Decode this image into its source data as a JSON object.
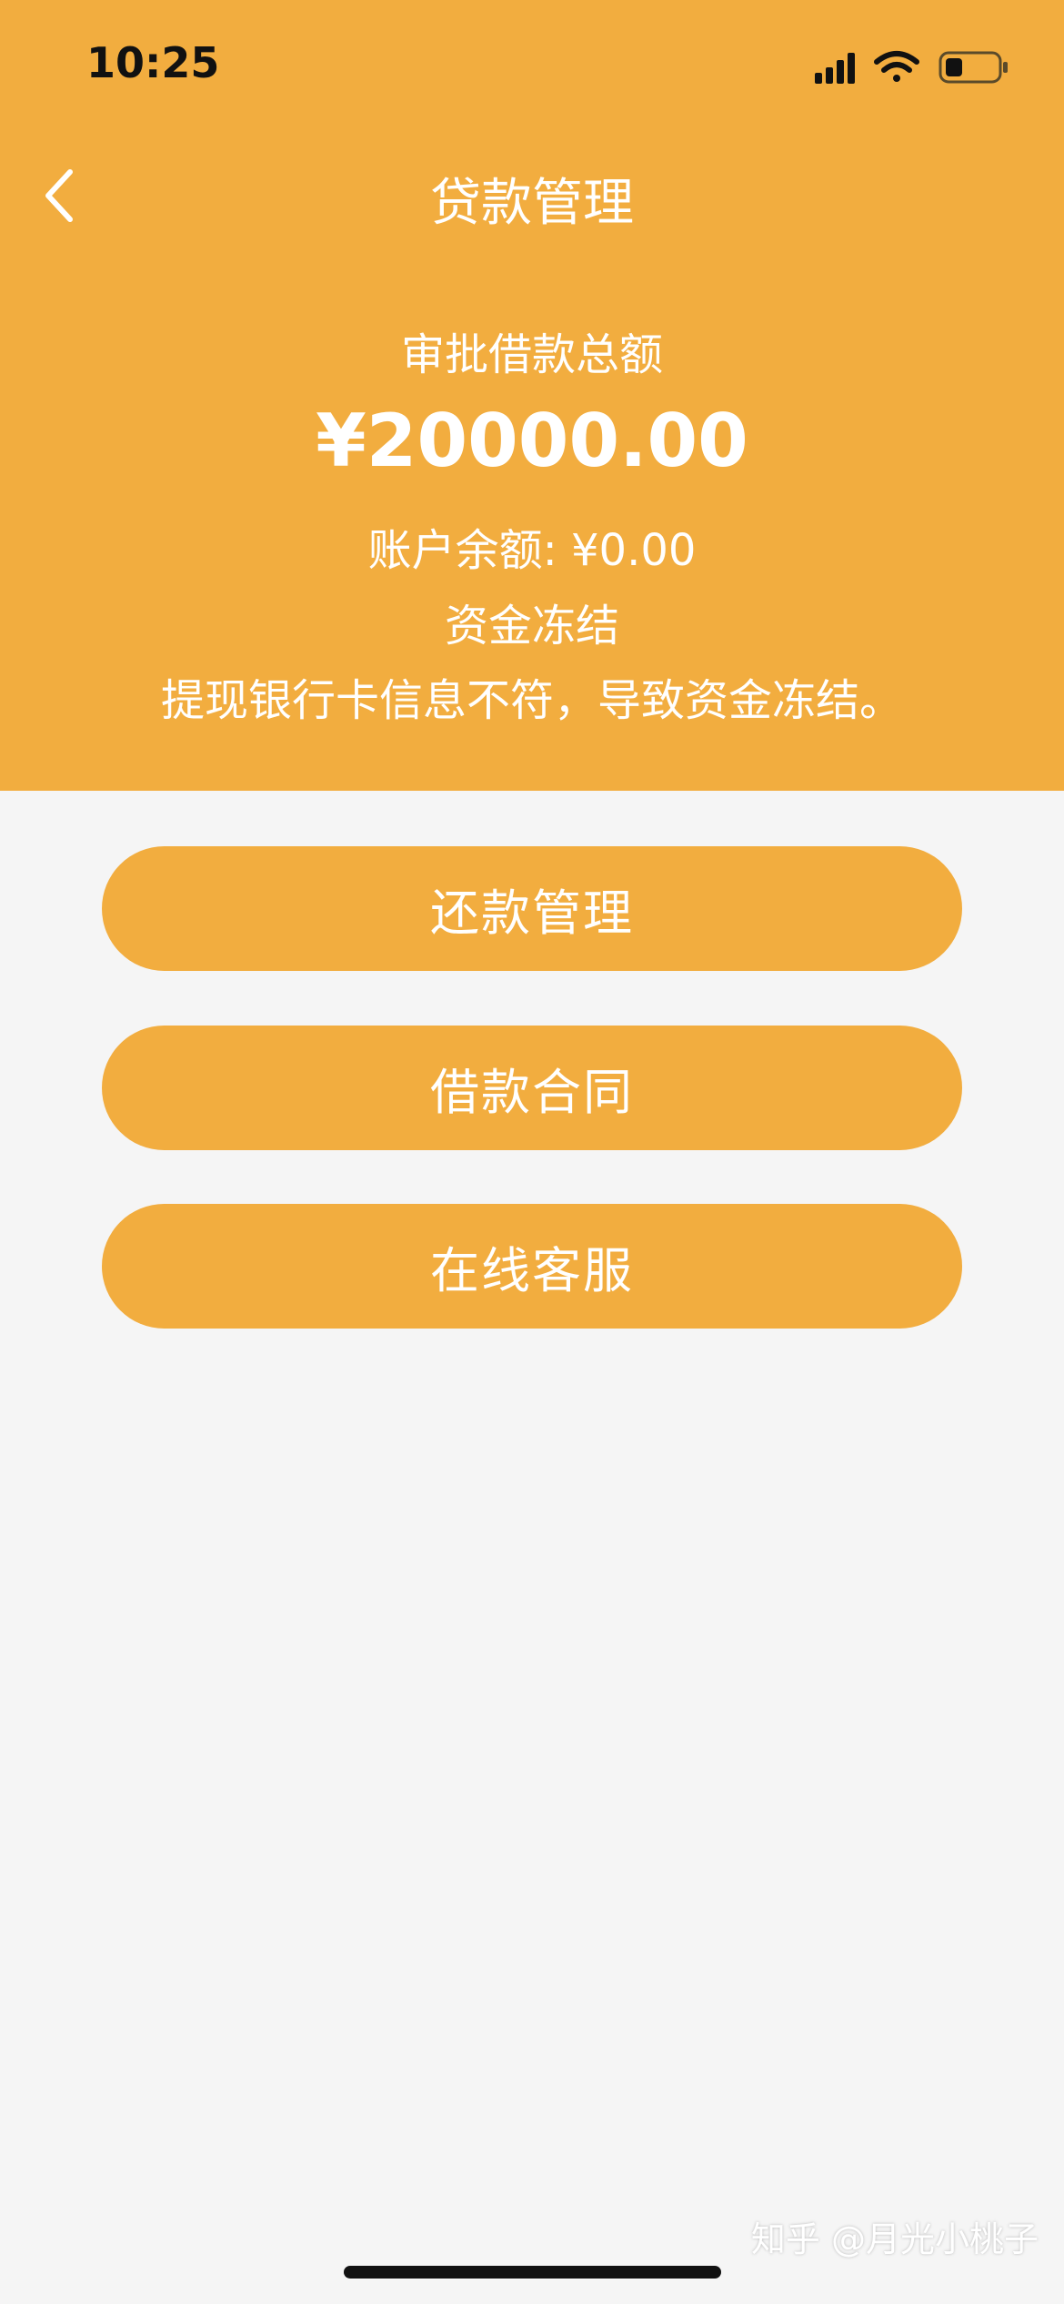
{
  "status_bar": {
    "time": "10:25",
    "icons": [
      "signal-icon",
      "wifi-icon",
      "battery-icon"
    ]
  },
  "nav": {
    "back_icon": "chevron-left-icon",
    "title": "贷款管理"
  },
  "summary": {
    "approved_label": "审批借款总额",
    "approved_amount": "¥20000.00",
    "balance": "账户余额: ¥0.00",
    "status": "资金冻结",
    "reason": "提现银行卡信息不符，导致资金冻结。"
  },
  "actions": [
    {
      "label": "还款管理"
    },
    {
      "label": "借款合同"
    },
    {
      "label": "在线客服"
    }
  ],
  "watermark": "知乎 @月光小桃子",
  "colors": {
    "accent": "#f2ad3f",
    "background": "#f5f5f5",
    "text_on_accent": "#ffffff"
  }
}
